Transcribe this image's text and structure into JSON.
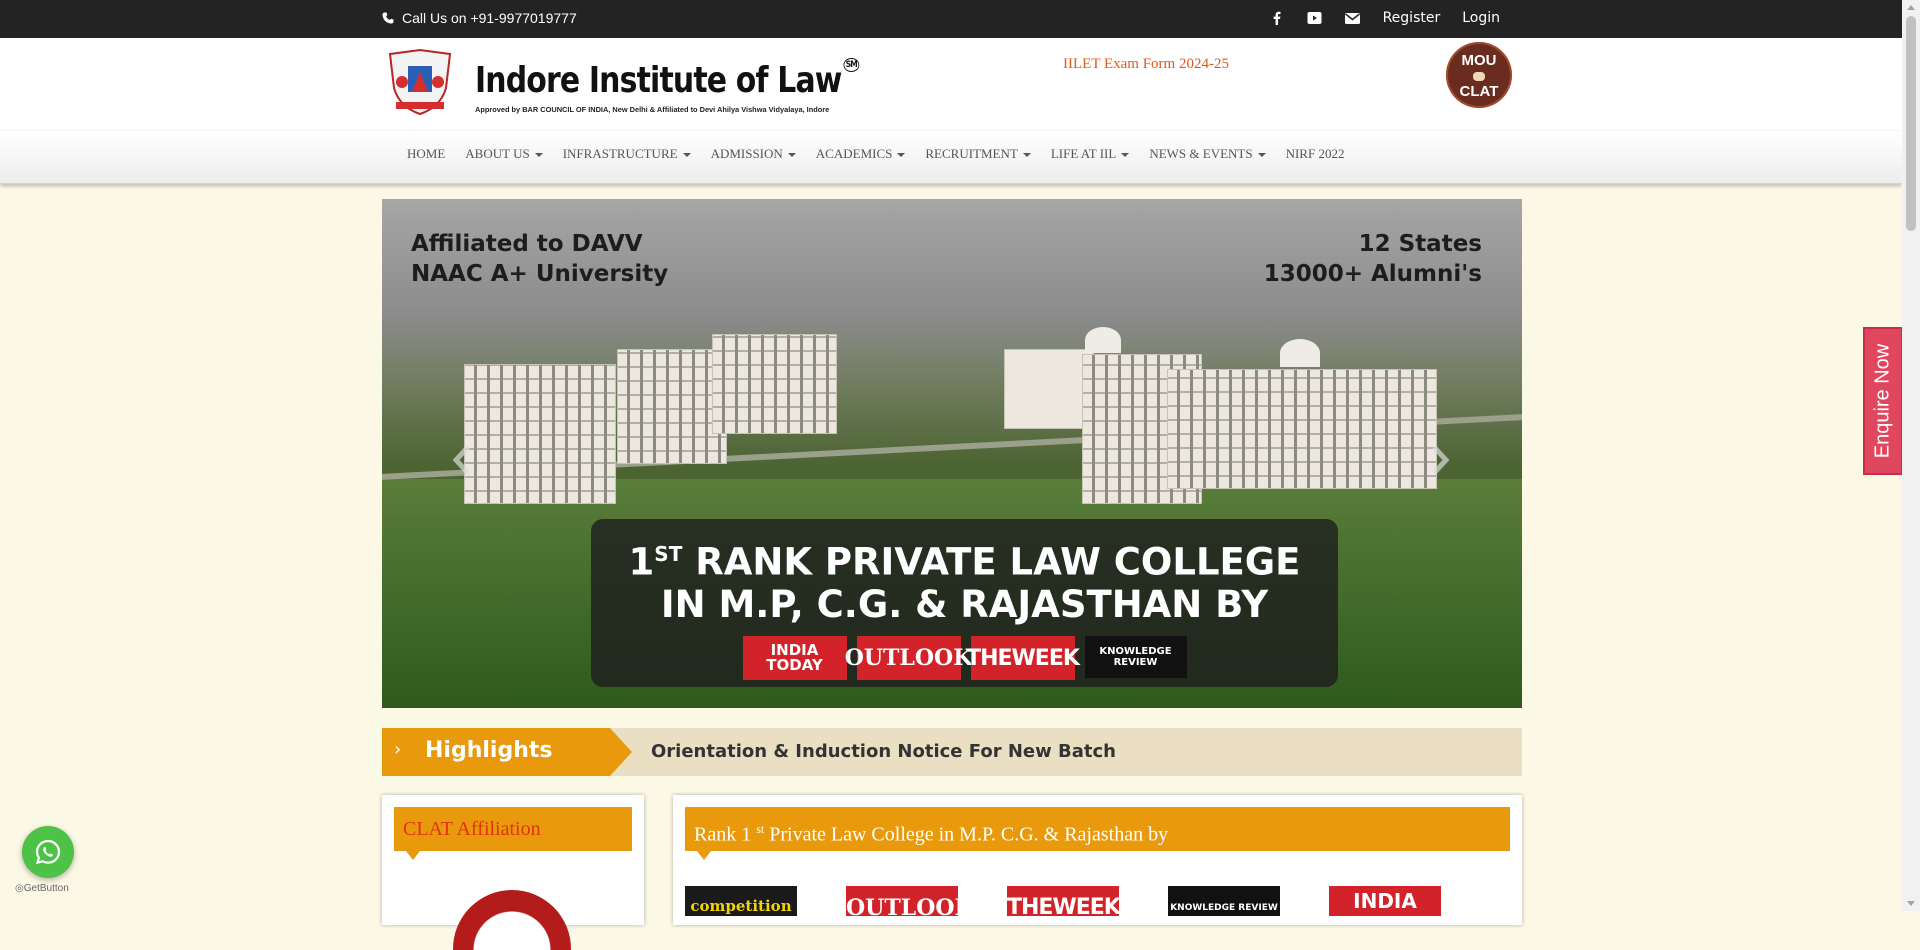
{
  "topbar": {
    "phone_text": "Call Us on +91-9977019777",
    "icons": [
      "facebook-icon",
      "youtube-icon",
      "envelope-icon"
    ],
    "register": "Register",
    "login": "Login"
  },
  "header": {
    "logo_name": "Indore Institute of Law",
    "logo_mark": "SM",
    "logo_subtitle": "Approved by BAR COUNCIL OF INDIA, New Delhi & Affiliated to Devi Ahilya Vishwa Vidyalaya, Indore",
    "exam_link": "IILET Exam Form 2024-25",
    "mou_top": "MOU",
    "mou_bottom": "CLAT"
  },
  "nav": {
    "items": [
      {
        "label": "HOME",
        "dropdown": false
      },
      {
        "label": "ABOUT US",
        "dropdown": true
      },
      {
        "label": "INFRASTRUCTURE",
        "dropdown": true
      },
      {
        "label": "ADMISSION",
        "dropdown": true
      },
      {
        "label": "ACADEMICS",
        "dropdown": true
      },
      {
        "label": "RECRUITMENT",
        "dropdown": true
      },
      {
        "label": "LIFE AT IIL",
        "dropdown": true
      },
      {
        "label": "NEWS & EVENTS",
        "dropdown": true
      },
      {
        "label": "NIRF 2022",
        "dropdown": false
      }
    ]
  },
  "slider": {
    "left_line1": "Affiliated to DAVV",
    "left_line2": "NAAC A+ University",
    "right_line1": "12 States",
    "right_line2": "13000+ Alumni's",
    "banner_rank": "1",
    "banner_rank_sup": "ST",
    "banner_line1_rest": " RANK PRIVATE LAW COLLEGE",
    "banner_line2": "IN M.P, C.G. & RAJASTHAN BY",
    "pub_india_today_1": "INDIA",
    "pub_india_today_2": "TODAY",
    "pub_outlook": "OUTLOOK",
    "pub_theweek": "THEWEEK",
    "pub_knowledge": "KNOWLEDGE REVIEW",
    "prev_icon": "chevron-left-icon",
    "next_icon": "chevron-right-icon"
  },
  "highlights": {
    "label": "Highlights",
    "text": "Orientation & Induction Notice For New Batch"
  },
  "clat_panel": {
    "title": "CLAT Affiliation"
  },
  "rank_panel": {
    "title_pre": "Rank 1 ",
    "title_sup": "st",
    "title_post": " Private Law College in M.P. C.G. & Rajasthan by",
    "logos": [
      "competition",
      "OUTLOOK",
      "THEWEEK",
      "KNOWLEDGE REVIEW",
      "INDIA TODAY"
    ]
  },
  "floating": {
    "enquire": "Enquire Now",
    "getbutton": "GetButton",
    "whatsapp_icon": "whatsapp-icon"
  },
  "colors": {
    "accent": "#e99a0c",
    "topbar": "#232323",
    "page_bg": "#fcf8e6",
    "enquire": "#e0465e",
    "whatsapp": "#4dc247"
  }
}
